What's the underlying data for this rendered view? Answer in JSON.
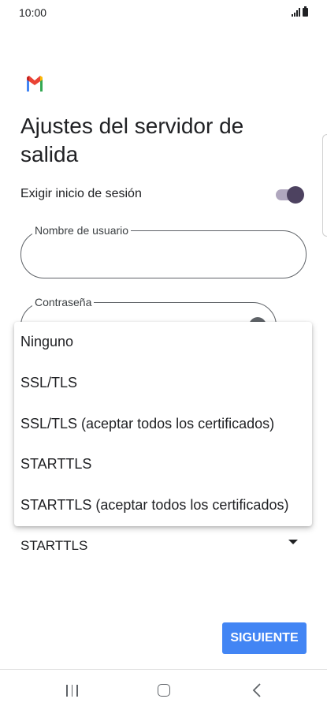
{
  "status_bar": {
    "time": "10:00",
    "icons": [
      "signal-icon",
      "battery-icon"
    ]
  },
  "app": {
    "logo": "gmail-logo",
    "colors": {
      "blue": "#4285F4",
      "red": "#EA4335",
      "yellow": "#FBBC04",
      "green": "#34A853"
    }
  },
  "page": {
    "title": "Ajustes del servidor de salida"
  },
  "require_login": {
    "label": "Exigir inicio de sesión",
    "enabled": true
  },
  "username_field": {
    "label": "Nombre de usuario",
    "value": ""
  },
  "password_field": {
    "label": "Contraseña",
    "value": ""
  },
  "security_select": {
    "selected": "STARTTLS",
    "options": [
      "Ninguno",
      "SSL/TLS",
      "SSL/TLS (aceptar todos los certificados)",
      "STARTTLS",
      "STARTTLS (aceptar todos los certificados)"
    ]
  },
  "next_button": {
    "label": "SIGUIENTE",
    "color": "#4285F4"
  },
  "nav_bar": {
    "icons": [
      "recents-icon",
      "home-icon",
      "back-icon"
    ]
  }
}
